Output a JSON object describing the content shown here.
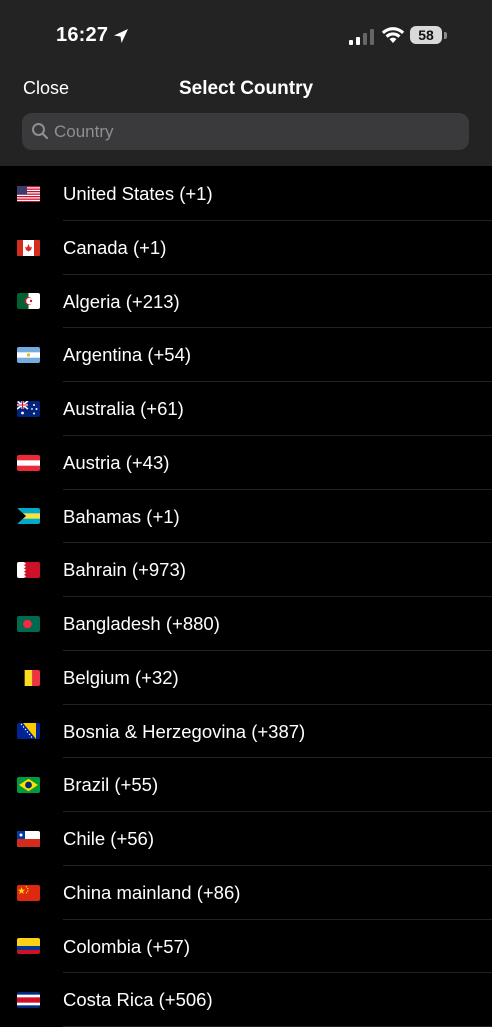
{
  "status_bar": {
    "time": "16:27",
    "battery": "58"
  },
  "nav": {
    "close_label": "Close",
    "title": "Select Country"
  },
  "search": {
    "placeholder": "Country"
  },
  "countries": [
    {
      "label": "United States (+1)",
      "flag": "us"
    },
    {
      "label": "Canada (+1)",
      "flag": "ca"
    },
    {
      "label": "Algeria (+213)",
      "flag": "dz"
    },
    {
      "label": "Argentina (+54)",
      "flag": "ar"
    },
    {
      "label": "Australia (+61)",
      "flag": "au"
    },
    {
      "label": "Austria (+43)",
      "flag": "at"
    },
    {
      "label": "Bahamas (+1)",
      "flag": "bs"
    },
    {
      "label": "Bahrain (+973)",
      "flag": "bh"
    },
    {
      "label": "Bangladesh (+880)",
      "flag": "bd"
    },
    {
      "label": "Belgium (+32)",
      "flag": "be"
    },
    {
      "label": "Bosnia & Herzegovina (+387)",
      "flag": "ba"
    },
    {
      "label": "Brazil (+55)",
      "flag": "br"
    },
    {
      "label": "Chile (+56)",
      "flag": "cl"
    },
    {
      "label": "China mainland (+86)",
      "flag": "cn"
    },
    {
      "label": "Colombia (+57)",
      "flag": "co"
    },
    {
      "label": "Costa Rica (+506)",
      "flag": "cr"
    }
  ]
}
